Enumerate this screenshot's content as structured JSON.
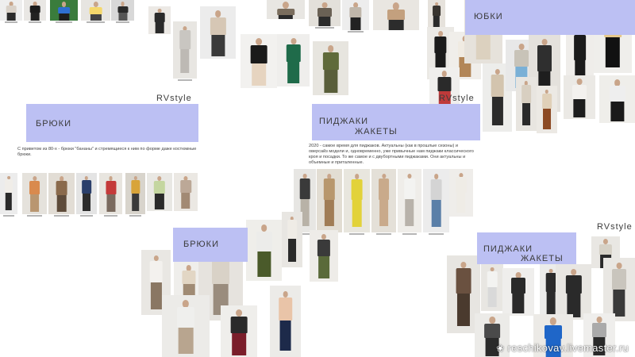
{
  "brand_label": "RVstyle",
  "sections": {
    "skirts": {
      "title": "ЮБКИ"
    },
    "trousers_top": {
      "title": "БРЮКИ",
      "description": "С приветом из 80-х - брюки \"бананы\" и стремящиеся к ним по форме даже костюмные брюки."
    },
    "jackets_top": {
      "title_line1": "ПИДЖАКИ",
      "title_line2": "ЖАКЕТЫ",
      "description": "2020 - самое время для пиджаков. Актуальны (как в прошлые сезоны) и оверсайз модели и, одновременно, уже привычные нам пиджаки классического кроя и посадки. То же самое и с двубортными пиджаками. Они актуальны и объемные и приталенные."
    },
    "trousers_bottom": {
      "title": "БРЮКИ"
    },
    "jackets_bottom": {
      "title_line1": "ПИДЖАКИ",
      "title_line2": "ЖАКЕТЫ"
    }
  },
  "watermark": {
    "text": "reschikovav.livemaster.ru"
  },
  "colors": {
    "accent_band": "#bcc0f3",
    "text": "#3a3a3a"
  }
}
